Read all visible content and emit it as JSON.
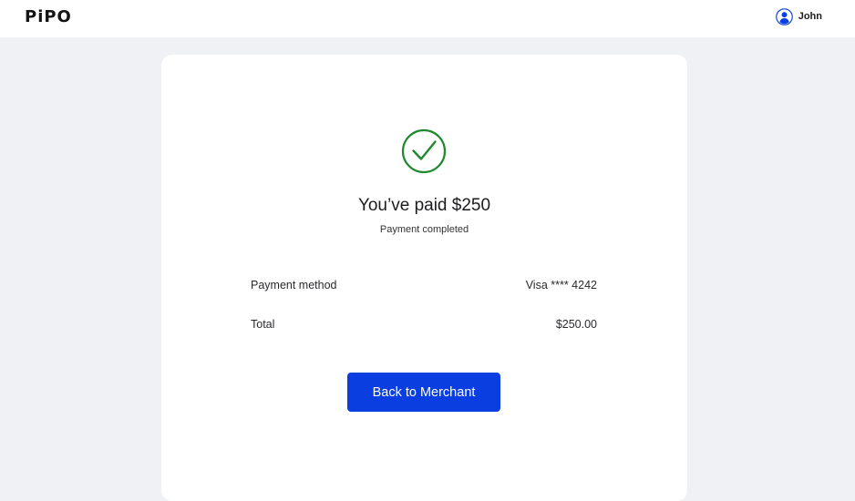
{
  "header": {
    "logo_text": "PiPO",
    "user_name": "John",
    "user_icon": "user-avatar-icon"
  },
  "confirmation": {
    "icon": "check-circle-icon",
    "title": "You’ve paid $250",
    "subtitle": "Payment completed",
    "details": [
      {
        "label": "Payment method",
        "value": "Visa **** 4242"
      },
      {
        "label": "Total",
        "value": "$250.00"
      }
    ],
    "button_label": "Back to Merchant"
  },
  "colors": {
    "brand_blue": "#0a3ee0",
    "success_green": "#1e8a2e",
    "page_bg": "#f0f1f5"
  }
}
